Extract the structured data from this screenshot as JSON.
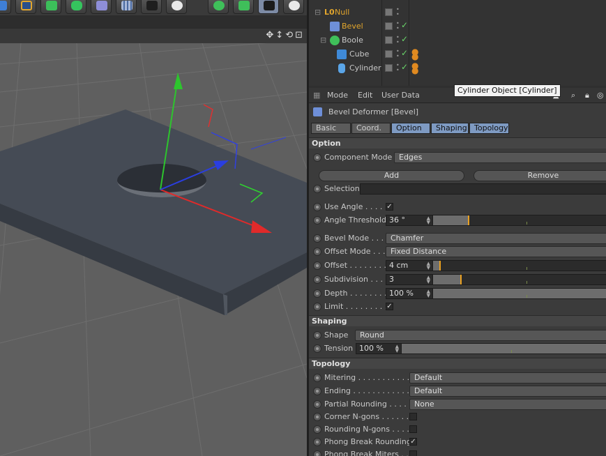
{
  "toolbar": {
    "icons": [
      "cube-primitive-icon",
      "spline-pen-icon",
      "nurbs-icon",
      "array-icon",
      "deformer-icon",
      "floor-icon",
      "camera-icon",
      "light-icon"
    ],
    "right_icons": [
      "mograph-cloner-icon",
      "tag-icon",
      "render-icon",
      "settings-gear-icon"
    ]
  },
  "viewport": {
    "nav_icons": [
      "✥",
      "↕",
      "⟲",
      "⊡"
    ]
  },
  "object_manager": {
    "objects": [
      {
        "name": "Null",
        "color": "#e3a62c",
        "indent": 0
      },
      {
        "name": "Bevel",
        "color": "#e3a62c",
        "indent": 1
      },
      {
        "name": "Boole",
        "color": "#c8c8c8",
        "indent": 1
      },
      {
        "name": "Cube",
        "color": "#c8c8c8",
        "indent": 2
      },
      {
        "name": "Cylinder",
        "color": "#c8c8c8",
        "indent": 2
      }
    ],
    "check_glyph": "✓"
  },
  "attributes": {
    "menu": [
      "Mode",
      "Edit",
      "User Data"
    ],
    "title": "Bevel Deformer [Bevel]",
    "tooltip": "Cylinder Object [Cylinder]",
    "tabs": [
      {
        "label": "Basic",
        "active": false
      },
      {
        "label": "Coord.",
        "active": false
      },
      {
        "label": "Option",
        "active": true
      },
      {
        "label": "Shaping",
        "active": true
      },
      {
        "label": "Topology",
        "active": true
      }
    ],
    "option": {
      "header": "Option",
      "component_mode_label": "Component Mode",
      "component_mode_value": "Edges",
      "add_label": "Add",
      "remove_label": "Remove",
      "selection_label": "Selection",
      "use_angle_label": "Use Angle . . . . .",
      "use_angle_checked": "✓",
      "angle_threshold_label": "Angle Threshold",
      "angle_threshold_value": "36 °",
      "angle_threshold_fraction": 0.2,
      "bevel_mode_label": "Bevel Mode . . . .",
      "bevel_mode_value": "Chamfer",
      "offset_mode_label": "Offset Mode . . .",
      "offset_mode_value": "Fixed Distance",
      "offset_label": "Offset . . . . . . . . .",
      "offset_value": "4 cm",
      "offset_fraction": 0.04,
      "subdivision_label": "Subdivision . . .",
      "subdivision_value": "3",
      "subdivision_fraction": 0.16,
      "depth_label": "Depth . . . . . . . .",
      "depth_value": "100 %",
      "limit_label": "Limit . . . . . . . . . .",
      "limit_checked": "✓"
    },
    "shaping": {
      "header": "Shaping",
      "shape_label": "Shape",
      "shape_value": "Round",
      "tension_label": "Tension",
      "tension_value": "100 %"
    },
    "topology": {
      "header": "Topology",
      "mitering_label": "Mitering . . . . . . . . . . . .",
      "mitering_value": "Default",
      "ending_label": "Ending . . . . . . . . . . . . .",
      "ending_value": "Default",
      "partial_label": "Partial Rounding . . . . .",
      "partial_value": "None",
      "corner_label": "Corner N-gons . . . . . .",
      "rounding_label": "Rounding N-gons . . . .",
      "phong_rounding_label": "Phong Break Rounding",
      "phong_rounding_checked": "✓",
      "phong_miters_label": "Phong Break Miters . . ."
    }
  },
  "colors": {
    "accent": "#e3a62c",
    "tab_active": "#7e9ac2",
    "check": "#6ad66a"
  }
}
